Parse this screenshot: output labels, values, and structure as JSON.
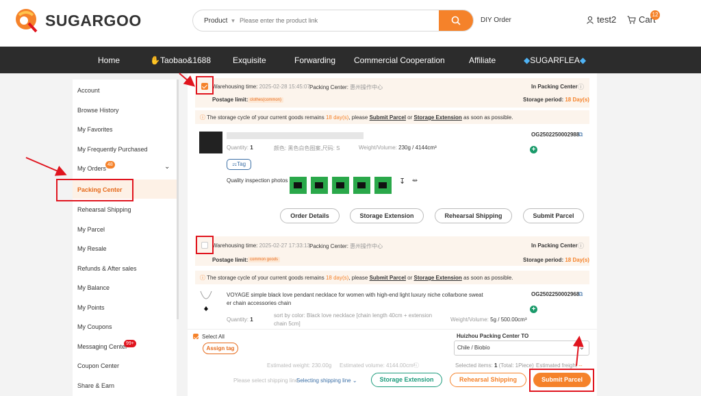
{
  "brand": {
    "name": "SUGARGOO",
    "accent": "#f5822a"
  },
  "search": {
    "type": "Product",
    "placeholder": "Please enter the product link"
  },
  "header": {
    "diy": "DIY Order",
    "user": "test2",
    "cart": "Cart",
    "cart_count": "12"
  },
  "nav": [
    "Home",
    "Taobao&1688",
    "Exquisite",
    "Forwarding",
    "Commercial Cooperation",
    "Affiliate",
    "SUGARFLEA"
  ],
  "sidebar": {
    "items": [
      "Account",
      "Browse History",
      "My Favorites",
      "My Frequently Purchased",
      "My Orders",
      "Packing Center",
      "Rehearsal Shipping",
      "My Parcel",
      "My Resale",
      "Refunds & After sales",
      "My Balance",
      "My Points",
      "My Coupons",
      "Messaging Center",
      "Coupon Center",
      "Share & Earn"
    ],
    "orders_badge": "48",
    "messages_badge": "99+"
  },
  "parcels": [
    {
      "wh_label": "Warehousing time:",
      "wh_time": "2025-02-28 15:45:07",
      "pc_label": "Packing Center:",
      "pc_value": "惠州操作中心",
      "status": "In Packing Center",
      "postage_label": "Postage limit:",
      "postage_chip": "clothes(common)",
      "period_label": "Storage period:",
      "period_value": "18 Day(s)",
      "notice_a": "The storage cycle of your current goods remains",
      "notice_days": "18 day(s)",
      "notice_b": ", please",
      "notice_submit": "Submit Parcel",
      "notice_or": "or",
      "notice_ext": "Storage Extension",
      "notice_c": "as soon as possible.",
      "order_id": "OG2502250002988",
      "quantity_label": "Quantity:",
      "quantity": "1",
      "color_label": "颜色: 黑色白色图案,尺码: S",
      "weight_label": "Weight/Volume:",
      "weight": "230g / 4144cm³",
      "tag": "Tag",
      "qc_label": "Quality inspection photos",
      "buttons": [
        "Order Details",
        "Storage Extension",
        "Rehearsal Shipping",
        "Submit Parcel"
      ]
    },
    {
      "wh_label": "Warehousing time:",
      "wh_time": "2025-02-27 17:33:13",
      "pc_label": "Packing Center:",
      "pc_value": "惠州操作中心",
      "status": "In Packing Center",
      "postage_label": "Postage limit:",
      "postage_chip": "common goods",
      "period_label": "Storage period:",
      "period_value": "18 Day(s)",
      "notice_a": "The storage cycle of your current goods remains",
      "notice_days": "18 day(s)",
      "notice_b": ", please",
      "notice_submit": "Submit Parcel",
      "notice_or": "or",
      "notice_ext": "Storage Extension",
      "notice_c": "as soon as possible.",
      "order_id": "OG2502250002968",
      "title1": "VOYAGE simple black love pendant necklace for women with high-end light luxury niche collarbone sweat",
      "title2": "er chain accessories chain",
      "quantity_label": "Quantity:",
      "quantity": "1",
      "sort1": "sort by color: Black love necklace [chain length 40cm + extension",
      "sort2": "chain 5cm]",
      "weight_label": "Weight/Volume:",
      "weight": "5g / 500.00cm³"
    }
  ],
  "footer": {
    "select_all": "Select All",
    "assign_tag": "Assign tag",
    "dest_label": "Huizhou Packing Center",
    "dest_to": "TO",
    "dest_value": "Chile / Biobío",
    "est_weight": "Estimated weight: 230.00g",
    "est_volume": "Estimated volume: 4144.00cm³",
    "selected": "Selected items:",
    "selected_num": "1",
    "selected_rest": "(Total: 1Piece)",
    "est_freight": "Estimated freight",
    "freight_value": "--",
    "shipline_hint": "Please select shipping line",
    "shipline_link": "Selecting shipping line",
    "btn_storage": "Storage Extension",
    "btn_rehearsal": "Rehearsal Shipping",
    "btn_submit": "Submit Parcel"
  }
}
